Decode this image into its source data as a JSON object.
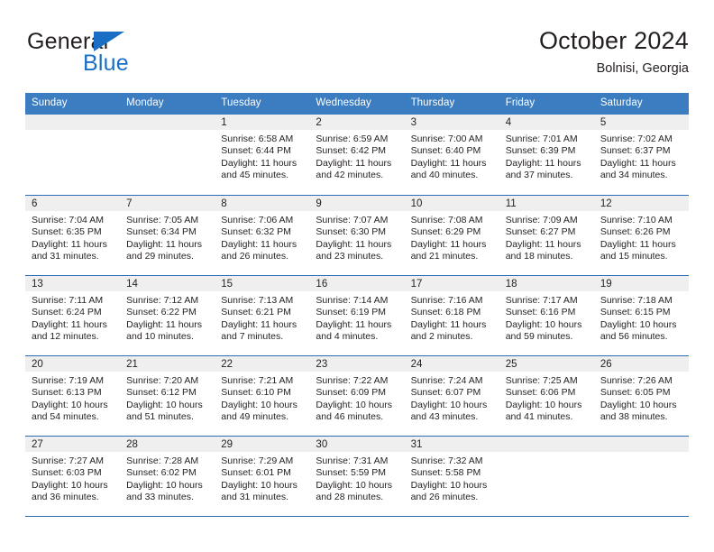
{
  "brand": {
    "word_one": "General",
    "word_two": "Blue",
    "triangle_icon": "blue-triangle-logo-mark"
  },
  "header": {
    "title": "October 2024",
    "subtitle": "Bolnisi, Georgia"
  },
  "colors": {
    "header_blue": "#3b7dc0",
    "row_divider_blue": "#2a6db5",
    "brand_blue": "#1a6fc4",
    "day_band_gray": "#efefef",
    "text": "#231f20"
  },
  "weekdays": [
    "Sunday",
    "Monday",
    "Tuesday",
    "Wednesday",
    "Thursday",
    "Friday",
    "Saturday"
  ],
  "weeks": [
    [
      {
        "day": "",
        "lines": []
      },
      {
        "day": "",
        "lines": []
      },
      {
        "day": "1",
        "lines": [
          "Sunrise: 6:58 AM",
          "Sunset: 6:44 PM",
          "Daylight: 11 hours",
          "and 45 minutes."
        ]
      },
      {
        "day": "2",
        "lines": [
          "Sunrise: 6:59 AM",
          "Sunset: 6:42 PM",
          "Daylight: 11 hours",
          "and 42 minutes."
        ]
      },
      {
        "day": "3",
        "lines": [
          "Sunrise: 7:00 AM",
          "Sunset: 6:40 PM",
          "Daylight: 11 hours",
          "and 40 minutes."
        ]
      },
      {
        "day": "4",
        "lines": [
          "Sunrise: 7:01 AM",
          "Sunset: 6:39 PM",
          "Daylight: 11 hours",
          "and 37 minutes."
        ]
      },
      {
        "day": "5",
        "lines": [
          "Sunrise: 7:02 AM",
          "Sunset: 6:37 PM",
          "Daylight: 11 hours",
          "and 34 minutes."
        ]
      }
    ],
    [
      {
        "day": "6",
        "lines": [
          "Sunrise: 7:04 AM",
          "Sunset: 6:35 PM",
          "Daylight: 11 hours",
          "and 31 minutes."
        ]
      },
      {
        "day": "7",
        "lines": [
          "Sunrise: 7:05 AM",
          "Sunset: 6:34 PM",
          "Daylight: 11 hours",
          "and 29 minutes."
        ]
      },
      {
        "day": "8",
        "lines": [
          "Sunrise: 7:06 AM",
          "Sunset: 6:32 PM",
          "Daylight: 11 hours",
          "and 26 minutes."
        ]
      },
      {
        "day": "9",
        "lines": [
          "Sunrise: 7:07 AM",
          "Sunset: 6:30 PM",
          "Daylight: 11 hours",
          "and 23 minutes."
        ]
      },
      {
        "day": "10",
        "lines": [
          "Sunrise: 7:08 AM",
          "Sunset: 6:29 PM",
          "Daylight: 11 hours",
          "and 21 minutes."
        ]
      },
      {
        "day": "11",
        "lines": [
          "Sunrise: 7:09 AM",
          "Sunset: 6:27 PM",
          "Daylight: 11 hours",
          "and 18 minutes."
        ]
      },
      {
        "day": "12",
        "lines": [
          "Sunrise: 7:10 AM",
          "Sunset: 6:26 PM",
          "Daylight: 11 hours",
          "and 15 minutes."
        ]
      }
    ],
    [
      {
        "day": "13",
        "lines": [
          "Sunrise: 7:11 AM",
          "Sunset: 6:24 PM",
          "Daylight: 11 hours",
          "and 12 minutes."
        ]
      },
      {
        "day": "14",
        "lines": [
          "Sunrise: 7:12 AM",
          "Sunset: 6:22 PM",
          "Daylight: 11 hours",
          "and 10 minutes."
        ]
      },
      {
        "day": "15",
        "lines": [
          "Sunrise: 7:13 AM",
          "Sunset: 6:21 PM",
          "Daylight: 11 hours",
          "and 7 minutes."
        ]
      },
      {
        "day": "16",
        "lines": [
          "Sunrise: 7:14 AM",
          "Sunset: 6:19 PM",
          "Daylight: 11 hours",
          "and 4 minutes."
        ]
      },
      {
        "day": "17",
        "lines": [
          "Sunrise: 7:16 AM",
          "Sunset: 6:18 PM",
          "Daylight: 11 hours",
          "and 2 minutes."
        ]
      },
      {
        "day": "18",
        "lines": [
          "Sunrise: 7:17 AM",
          "Sunset: 6:16 PM",
          "Daylight: 10 hours",
          "and 59 minutes."
        ]
      },
      {
        "day": "19",
        "lines": [
          "Sunrise: 7:18 AM",
          "Sunset: 6:15 PM",
          "Daylight: 10 hours",
          "and 56 minutes."
        ]
      }
    ],
    [
      {
        "day": "20",
        "lines": [
          "Sunrise: 7:19 AM",
          "Sunset: 6:13 PM",
          "Daylight: 10 hours",
          "and 54 minutes."
        ]
      },
      {
        "day": "21",
        "lines": [
          "Sunrise: 7:20 AM",
          "Sunset: 6:12 PM",
          "Daylight: 10 hours",
          "and 51 minutes."
        ]
      },
      {
        "day": "22",
        "lines": [
          "Sunrise: 7:21 AM",
          "Sunset: 6:10 PM",
          "Daylight: 10 hours",
          "and 49 minutes."
        ]
      },
      {
        "day": "23",
        "lines": [
          "Sunrise: 7:22 AM",
          "Sunset: 6:09 PM",
          "Daylight: 10 hours",
          "and 46 minutes."
        ]
      },
      {
        "day": "24",
        "lines": [
          "Sunrise: 7:24 AM",
          "Sunset: 6:07 PM",
          "Daylight: 10 hours",
          "and 43 minutes."
        ]
      },
      {
        "day": "25",
        "lines": [
          "Sunrise: 7:25 AM",
          "Sunset: 6:06 PM",
          "Daylight: 10 hours",
          "and 41 minutes."
        ]
      },
      {
        "day": "26",
        "lines": [
          "Sunrise: 7:26 AM",
          "Sunset: 6:05 PM",
          "Daylight: 10 hours",
          "and 38 minutes."
        ]
      }
    ],
    [
      {
        "day": "27",
        "lines": [
          "Sunrise: 7:27 AM",
          "Sunset: 6:03 PM",
          "Daylight: 10 hours",
          "and 36 minutes."
        ]
      },
      {
        "day": "28",
        "lines": [
          "Sunrise: 7:28 AM",
          "Sunset: 6:02 PM",
          "Daylight: 10 hours",
          "and 33 minutes."
        ]
      },
      {
        "day": "29",
        "lines": [
          "Sunrise: 7:29 AM",
          "Sunset: 6:01 PM",
          "Daylight: 10 hours",
          "and 31 minutes."
        ]
      },
      {
        "day": "30",
        "lines": [
          "Sunrise: 7:31 AM",
          "Sunset: 5:59 PM",
          "Daylight: 10 hours",
          "and 28 minutes."
        ]
      },
      {
        "day": "31",
        "lines": [
          "Sunrise: 7:32 AM",
          "Sunset: 5:58 PM",
          "Daylight: 10 hours",
          "and 26 minutes."
        ]
      },
      {
        "day": "",
        "lines": []
      },
      {
        "day": "",
        "lines": []
      }
    ]
  ]
}
